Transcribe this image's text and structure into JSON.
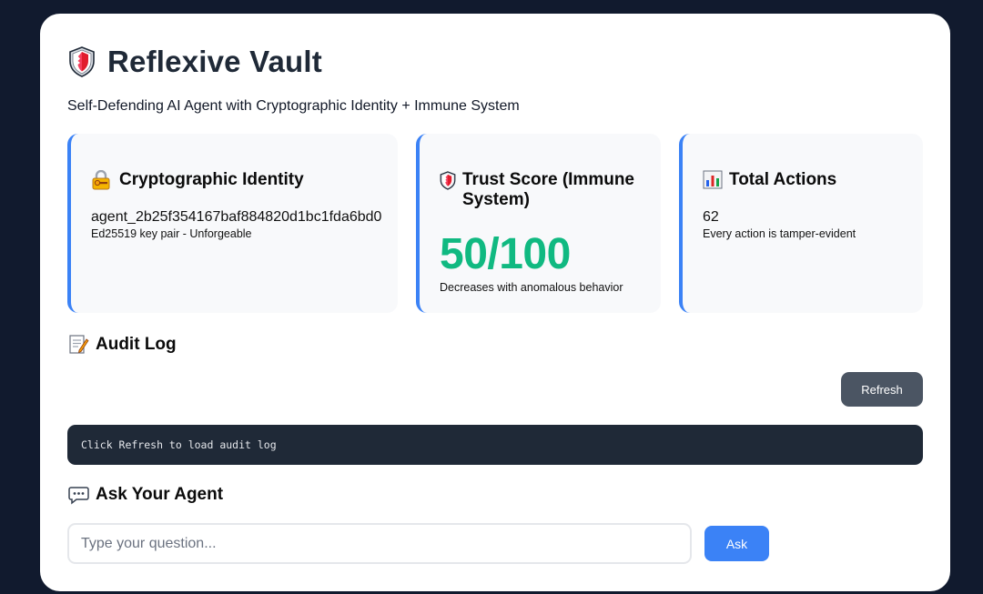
{
  "header": {
    "title": "Reflexive Vault",
    "subtitle": "Self-Defending AI Agent with Cryptographic Identity + Immune System"
  },
  "stats": {
    "identity": {
      "icon": "lock-with-key-icon",
      "heading": "Cryptographic Identity",
      "value": "agent_2b25f354167baf884820d1bc1fda6bd0",
      "note": "Ed25519 key pair - Unforgeable"
    },
    "trust": {
      "icon": "shield-icon",
      "heading": "Trust Score (Immune System)",
      "value": "50/100",
      "note": "Decreases with anomalous behavior"
    },
    "actions": {
      "icon": "bar-chart-icon",
      "heading": "Total Actions",
      "value": "62",
      "note": "Every action is tamper-evident"
    }
  },
  "audit": {
    "icon": "memo-icon",
    "heading": "Audit Log",
    "refresh_label": "Refresh",
    "log_text": "Click Refresh to load audit log"
  },
  "ask": {
    "icon": "speech-bubble-icon",
    "heading": "Ask Your Agent",
    "placeholder": "Type your question...",
    "button_label": "Ask"
  },
  "colors": {
    "page_bg": "#111a2e",
    "accent": "#3b82f6",
    "trust_green": "#10b981",
    "log_bg": "#1f2937",
    "refresh_bg": "#4b5563"
  }
}
